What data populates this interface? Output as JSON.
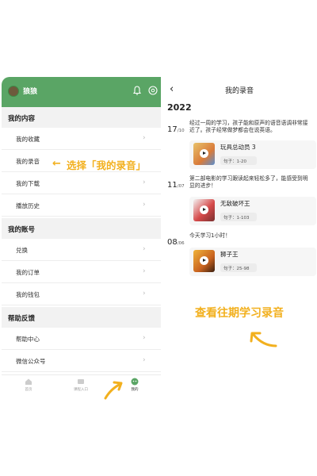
{
  "left": {
    "username": "狼狼",
    "sections": [
      {
        "title": "我的内容",
        "items": [
          "我的收藏",
          "我的录音",
          "我的下载",
          "播放历史"
        ]
      },
      {
        "title": "我的账号",
        "items": [
          "兑换",
          "我的订单",
          "我的钱包"
        ]
      },
      {
        "title": "帮助反馈",
        "items": [
          "帮助中心",
          "微信公众号"
        ]
      }
    ],
    "tabs": [
      {
        "label": "首页",
        "icon": "home-icon"
      },
      {
        "label": "课程入口",
        "icon": "course-icon"
      },
      {
        "label": "我的",
        "icon": "me-icon",
        "active": true
      }
    ],
    "accent": "#5aa565"
  },
  "annotation1": "选择「我的录音」",
  "right": {
    "title": "我的录音",
    "year": "2022",
    "entries": [
      {
        "day": "17",
        "month": "/10",
        "text": "经过一周的学习，孩子能和原声的语音语调非常接近了。孩子经常做梦都会在说英语。",
        "card_title": "玩具总动员 3",
        "card_sub": "句子：1-20"
      },
      {
        "day": "11",
        "month": "/07",
        "text": "第二部电影的学习跟读起来轻松多了，能感受到明显的进步！",
        "card_title": "无敌破坏王",
        "card_sub": "句子：1-103"
      },
      {
        "day": "08",
        "month": "/06",
        "text": "今天学习1小时！",
        "card_title": "狮子王",
        "card_sub": "句子：25-98"
      }
    ]
  },
  "annotation2": "查看往期学习录音",
  "annotation_color": "#f2b01e"
}
